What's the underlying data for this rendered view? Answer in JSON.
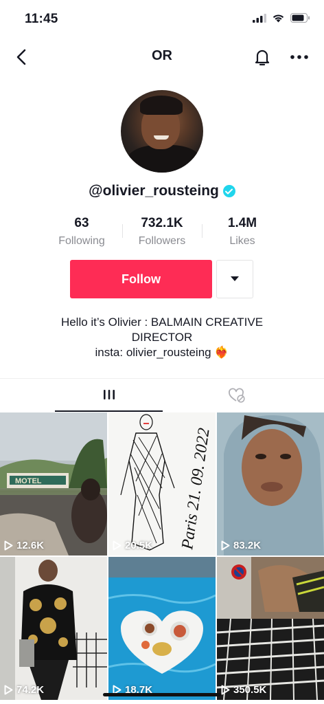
{
  "status_bar": {
    "time": "11:45"
  },
  "nav": {
    "title": "OR"
  },
  "profile": {
    "username": "@olivier_rousteing",
    "verified": true,
    "accent_color": "#fe2c55",
    "verified_color": "#20d5ec"
  },
  "stats": [
    {
      "value": "63",
      "label": "Following"
    },
    {
      "value": "732.1K",
      "label": "Followers"
    },
    {
      "value": "1.4M",
      "label": "Likes"
    }
  ],
  "actions": {
    "follow_label": "Follow"
  },
  "bio": {
    "line1": "Hello it’s Olivier : BALMAIN CREATIVE",
    "line2": "DIRECTOR",
    "line3": "insta: olivier_rousteing ❤️‍🔥"
  },
  "tabs": [
    {
      "icon": "grid-icon",
      "active": true
    },
    {
      "icon": "liked-hidden-icon",
      "active": false
    }
  ],
  "videos": [
    {
      "views": "12.6K",
      "sign_text": "MOTEL"
    },
    {
      "views": "20.5K",
      "sketch_text": "Paris 21. 09. 2022"
    },
    {
      "views": "83.2K"
    },
    {
      "views": "74.2K"
    },
    {
      "views": "18.7K"
    },
    {
      "views": "350.5K"
    }
  ]
}
